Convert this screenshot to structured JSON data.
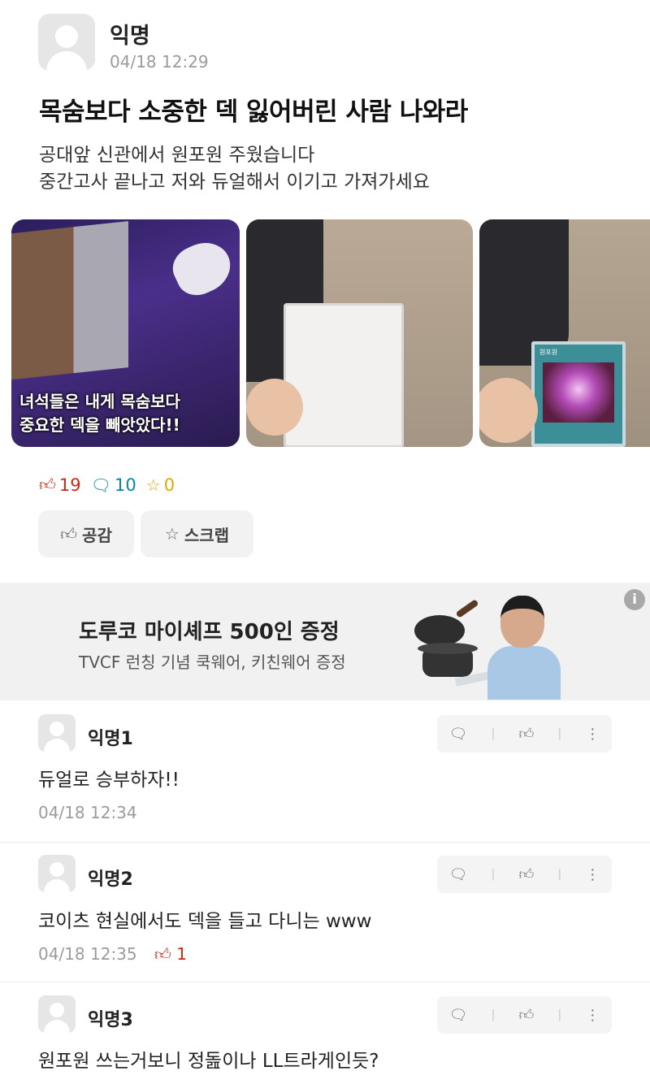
{
  "post": {
    "author": "익명",
    "time": "04/18 12:29",
    "title": "목숨보다 소중한 덱 잃어버린 사람 나와라",
    "body": "공대앞 신관에서 원포원 주웠습니다\n중간고사 끝나고 저와 듀얼해서 이기고 가져가세요",
    "images": [
      {
        "caption": "녀석들은 내게 목숨보다\n중요한 덱을 빼앗았다!!"
      },
      {
        "caption": ""
      },
      {
        "caption": "원포원"
      }
    ],
    "stats": {
      "likes": "19",
      "comments": "10",
      "scraps": "0"
    },
    "buttons": {
      "like": "공감",
      "scrap": "스크랩"
    }
  },
  "ad": {
    "title": "도루코 마이셰프 500인 증정",
    "subtitle": "TVCF 런칭 기념 쿡웨어, 키친웨어 증정",
    "info": "i"
  },
  "comments": [
    {
      "author": "익명1",
      "text": "듀얼로 승부하자!!",
      "time": "04/18 12:34",
      "likes": ""
    },
    {
      "author": "익명2",
      "text": "코이츠 현실에서도 덱을 들고 다니는 www",
      "time": "04/18 12:35",
      "likes": "1"
    },
    {
      "author": "익명3",
      "text": "원포원 쓰는거보니 정돒이나 LL트라게인듯?",
      "time": "",
      "likes": ""
    }
  ],
  "icons": {
    "like": "thumbs-up-icon",
    "comment": "speech-bubble-icon",
    "scrap": "star-icon",
    "more": "more-vertical-icon"
  },
  "colors": {
    "like": "#c62917",
    "comment": "#0a86a8",
    "scrap": "#e0a800"
  }
}
